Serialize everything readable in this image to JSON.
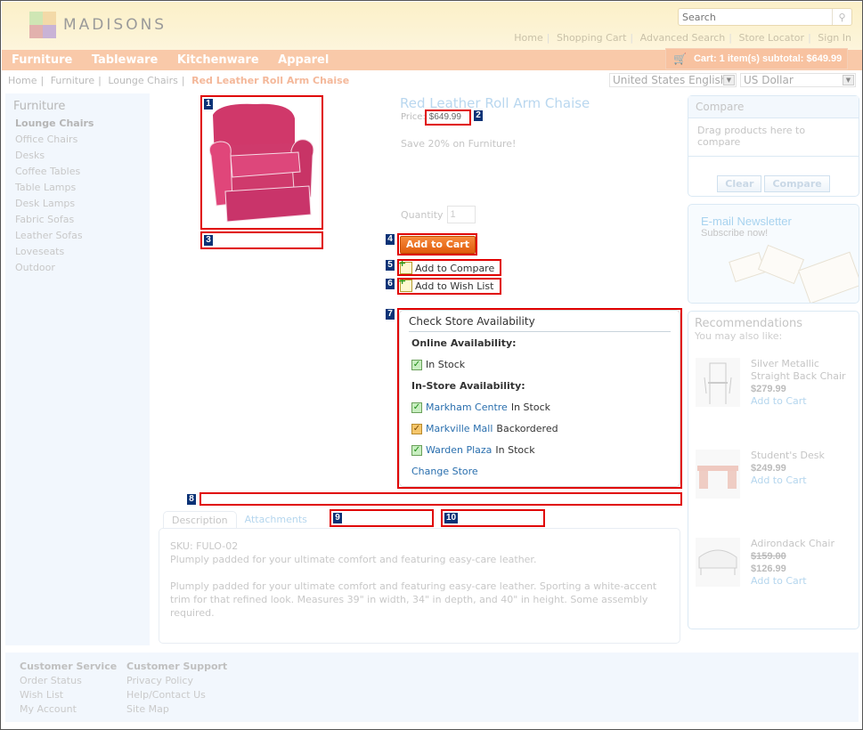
{
  "brand": {
    "name": "MADISONS"
  },
  "search": {
    "placeholder": "Search"
  },
  "top_links": [
    "Home",
    "Shopping Cart",
    "Advanced Search",
    "Store Locator",
    "Sign In"
  ],
  "nav": [
    "Furniture",
    "Tableware",
    "Kitchenware",
    "Apparel"
  ],
  "cart": {
    "label": "Cart: 1 item(s) subtotal: $649.99"
  },
  "breadcrumb": {
    "items": [
      "Home",
      "Furniture",
      "Lounge Chairs"
    ],
    "current": "Red Leather Roll Arm Chaise"
  },
  "language": {
    "selected": "United States English"
  },
  "currency": {
    "selected": "US Dollar"
  },
  "sidebar": {
    "title": "Furniture",
    "items": [
      "Lounge Chairs",
      "Office Chairs",
      "Desks",
      "Coffee Tables",
      "Table Lamps",
      "Desk Lamps",
      "Fabric Sofas",
      "Leather Sofas",
      "Loveseats",
      "Outdoor"
    ],
    "active": "Lounge Chairs"
  },
  "product": {
    "title": "Red Leather Roll Arm Chaise",
    "price_label": "Price:",
    "price": "$649.99",
    "promo": "Save 20% on Furniture!",
    "quantity_label": "Quantity",
    "quantity": "1",
    "add_to_cart": "Add to Cart",
    "add_to_compare": "Add to Compare",
    "add_to_wishlist": "Add to Wish List"
  },
  "availability": {
    "title": "Check Store Availability",
    "online_label": "Online Availability:",
    "online_status": "In Stock",
    "instore_label": "In-Store Availability:",
    "stores": [
      {
        "name": "Markham Centre",
        "status": "In Stock",
        "state": "ok"
      },
      {
        "name": "Markville Mall",
        "status": "Backordered",
        "state": "warn"
      },
      {
        "name": "Warden Plaza",
        "status": "In Stock",
        "state": "ok"
      }
    ],
    "change_store": "Change Store"
  },
  "tabs": [
    "Description",
    "Attachments"
  ],
  "description": {
    "sku": "SKU: FULO-02",
    "short": "Plumply padded for your ultimate comfort and featuring easy-care leather.",
    "long": "Plumply padded for your ultimate comfort and featuring easy-care leather. Sporting a white-accent trim for that refined look. Measures 39\" in width, 34\" in depth, and 40\" in height. Some assembly required."
  },
  "compare": {
    "title": "Compare",
    "hint": "Drag products here to compare",
    "clear": "Clear",
    "compare": "Compare"
  },
  "newsletter": {
    "title": "E-mail Newsletter",
    "subtitle": "Subscribe now!"
  },
  "recommendations": {
    "title": "Recommendations",
    "subtitle": "You may also like:",
    "items": [
      {
        "name": "Silver Metallic Straight Back Chair",
        "price": "$279.99",
        "old_price": null,
        "add": "Add to Cart"
      },
      {
        "name": "Student's Desk",
        "price": "$249.99",
        "old_price": null,
        "add": "Add to Cart"
      },
      {
        "name": "Adirondack Chair",
        "price": "$126.99",
        "old_price": "$159.00",
        "add": "Add to Cart"
      }
    ]
  },
  "footer": {
    "columns": [
      {
        "title": "Customer Service",
        "links": [
          "Order Status",
          "Wish List",
          "My Account"
        ]
      },
      {
        "title": "Customer Support",
        "links": [
          "Privacy Policy",
          "Help/Contact Us",
          "Site Map"
        ]
      }
    ]
  },
  "annotations": [
    "1",
    "2",
    "3",
    "4",
    "5",
    "6",
    "7",
    "8",
    "9",
    "10"
  ]
}
